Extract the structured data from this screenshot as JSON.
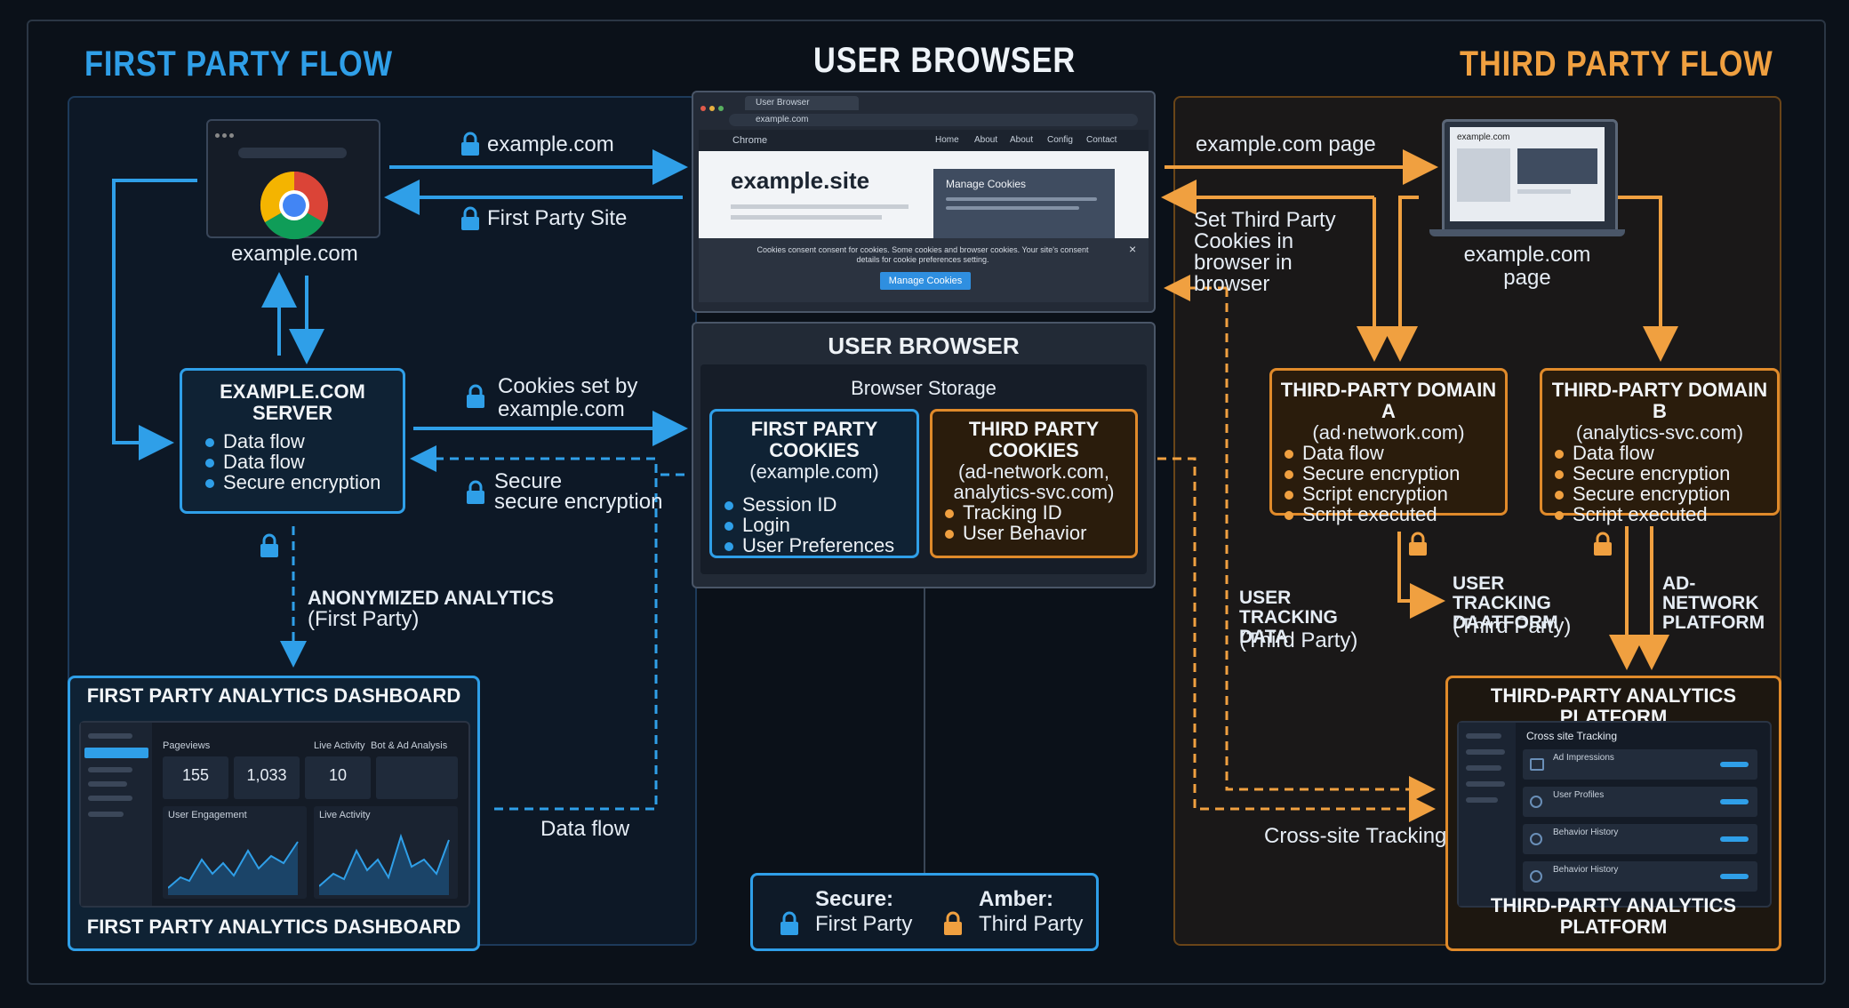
{
  "titles": {
    "first_party": "FIRST PARTY FLOW",
    "user_browser": "USER BROWSER",
    "third_party": "THIRD PARTY FLOW"
  },
  "colors": {
    "first_party": "#2f9fe8",
    "third_party": "#f0a040",
    "background": "#0b1119"
  },
  "first_party": {
    "site_label": "example.com",
    "server": {
      "title": "EXAMPLE.COM SERVER",
      "items": [
        "Data flow",
        "Data flow",
        "Secure encryption"
      ]
    },
    "dashboard": {
      "title_top": "FIRST PARTY ANALYTICS DASHBOARD",
      "title_bottom": "FIRST PARTY ANALYTICS DASHBOARD",
      "section_a": "Pageviews",
      "section_b": "Live Activity",
      "section_c": "Bot & Ad Analysis",
      "stats": [
        "155",
        "1,033",
        "10"
      ],
      "chart_a": "User Engagement",
      "chart_b": "Live Activity"
    }
  },
  "arrows": {
    "fp_request": "example.com",
    "fp_response": "First Party Site",
    "cookies_set": "Cookies set by example.com",
    "secure": "Secure",
    "secure_sub": "secure encryption",
    "anon": "ANONYMIZED ANALYTICS",
    "anon_sub": "(First Party)",
    "data_flow": "Data flow",
    "tp_page": "example.com page",
    "set_tp": "Set Third Party Cookies in browser in browser",
    "user_tracking": "USER TRACKING DATA",
    "user_tracking_sub": "(Third Party)",
    "user_tracking_b": "USER TRACKING DAATFORM",
    "user_tracking_b_sub": "(Third Party)",
    "ad_network": "AD-NETWORK PLATFORM",
    "cross_site": "Cross-site Tracking"
  },
  "browser": {
    "tab_label": "User Browser",
    "url": "example.com",
    "brand": "Chrome",
    "nav": [
      "Home",
      "About",
      "About",
      "Config",
      "Contact"
    ],
    "site_title": "example.site",
    "manage_title": "Manage Cookies",
    "banner_text": "Cookies consent consent for cookies. Some cookies and browser cookies. Your site's consent details for cookie preferences setting.",
    "banner_button": "Manage Cookies",
    "storage_title": "USER BROWSER",
    "storage_sub": "Browser Storage",
    "fp_cookies": {
      "title": "FIRST PARTY COOKIES",
      "sub": "(example.com)",
      "items": [
        "Session ID",
        "Login",
        "User Preferences"
      ]
    },
    "tp_cookies": {
      "title": "THIRD PARTY COOKIES",
      "sub": "(ad-network.com, analytics-svc.com)",
      "items": [
        "Tracking ID",
        "User Behavior"
      ]
    }
  },
  "third_party": {
    "page_label": "example.com page",
    "laptop_header": "example.com",
    "domain_a": {
      "title": "THIRD-PARTY DOMAIN A",
      "sub": "(ad·network.com)",
      "items": [
        "Data flow",
        "Secure encryption",
        "Script encryption",
        "Script executed"
      ]
    },
    "domain_b": {
      "title": "THIRD-PARTY DOMAIN B",
      "sub": "(analytics-svc.com)",
      "items": [
        "Data flow",
        "Secure encryption",
        "Secure encryption",
        "Script executed"
      ]
    },
    "platform": {
      "title_top": "THIRD-PARTY ANALYTICS PLATFORM",
      "title_bottom": "THIRD-PARTY ANALYTICS PLATFORM",
      "header": "Cross site Tracking",
      "rows": [
        "Ad Impressions",
        "User Profiles",
        "Behavior History",
        "Behavior History"
      ]
    }
  },
  "legend": {
    "secure_label": "Secure:",
    "secure_value": "First Party",
    "amber_label": "Amber:",
    "amber_value": "Third Party"
  }
}
